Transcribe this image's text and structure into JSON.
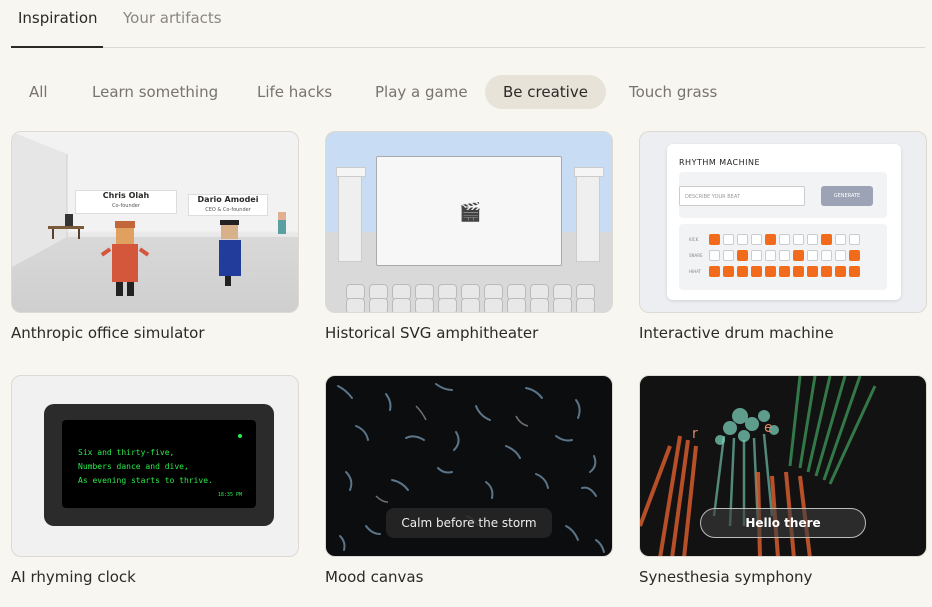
{
  "tabs": [
    {
      "label": "Inspiration"
    },
    {
      "label": "Your artifacts"
    }
  ],
  "categories": [
    {
      "label": "All"
    },
    {
      "label": "Learn something"
    },
    {
      "label": "Life hacks"
    },
    {
      "label": "Play a game"
    },
    {
      "label": "Be creative"
    },
    {
      "label": "Touch grass"
    }
  ],
  "selected_category": "Be creative",
  "cards": [
    {
      "title": "Anthropic office simulator",
      "namecards": [
        {
          "name": "Chris Olah",
          "role": "Co-founder"
        },
        {
          "name": "Dario Amodei",
          "role": "CEO & Co-founder"
        }
      ]
    },
    {
      "title": "Historical SVG amphitheater",
      "icon": "clapperboard-icon"
    },
    {
      "title": "Interactive drum machine",
      "heading": "RHYTHM MACHINE",
      "input_placeholder": "DESCRIBE YOUR BEAT",
      "button": "GENERATE",
      "rows": [
        {
          "label": "KICK",
          "steps": [
            1,
            0,
            0,
            0,
            1,
            0,
            0,
            0,
            1,
            0,
            0
          ]
        },
        {
          "label": "SNARE",
          "steps": [
            0,
            0,
            1,
            0,
            0,
            0,
            1,
            0,
            0,
            0,
            1
          ]
        },
        {
          "label": "HIHAT",
          "steps": [
            1,
            1,
            1,
            1,
            1,
            1,
            1,
            1,
            1,
            1,
            1
          ]
        }
      ]
    },
    {
      "title": "AI rhyming clock",
      "poem": [
        "Six and thirty-five,",
        "Numbers dance and dive,",
        "As evening starts to thrive."
      ],
      "time": "18:35 PM"
    },
    {
      "title": "Mood canvas",
      "overlay": "Calm before the storm"
    },
    {
      "title": "Synesthesia symphony",
      "overlay": "Hello there",
      "letters": [
        "r",
        "e"
      ]
    }
  ],
  "colors": {
    "background": "#f8f6f1",
    "active_chip": "#e7e3d8",
    "drum_on": "#f26a1b",
    "clock_text": "#2bea4b"
  }
}
